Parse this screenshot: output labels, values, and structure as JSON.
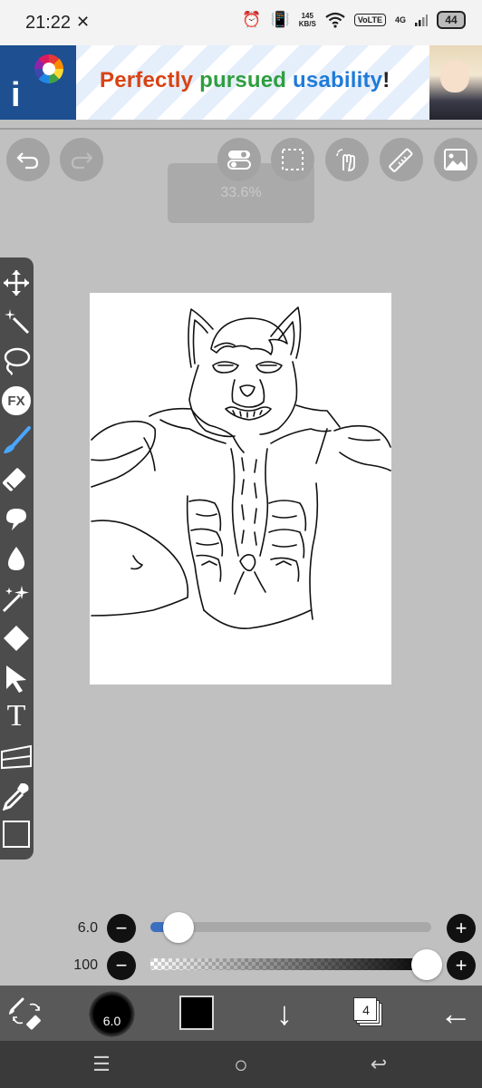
{
  "status_bar": {
    "time": "21:22",
    "time_icon": "✕",
    "alarm_icon": "⏰",
    "vibrate_icon": "📳",
    "speed_value": "145",
    "speed_unit": "KB/S",
    "wifi_icon": "wifi-icon",
    "volte": "VoLTE",
    "network": "4G",
    "battery": "44"
  },
  "ad_banner": {
    "word1": "Perfectly",
    "word2": "pursued",
    "word3": "usability",
    "word4": "!"
  },
  "top_toolbar": {
    "undo": "↶",
    "redo": "↷",
    "zoom": "33.6%"
  },
  "tools": [
    "move",
    "magic-wand",
    "lasso",
    "FX",
    "brush",
    "eraser",
    "smudge",
    "blur",
    "sparkle",
    "fill",
    "select",
    "T",
    "transform",
    "eyedropper",
    "layer"
  ],
  "sliders": {
    "size_value": "6.0",
    "size_fraction": 0.1,
    "opacity_value": "100",
    "opacity_fraction": 1.0,
    "minus": "−",
    "plus": "+"
  },
  "bottom_toolbar": {
    "brush_size": "6.0",
    "color": "#000000",
    "download": "↓",
    "layers_count": "4",
    "back": "←"
  },
  "nav_bar": {
    "menu": "☰",
    "home": "○",
    "back": "↩"
  }
}
